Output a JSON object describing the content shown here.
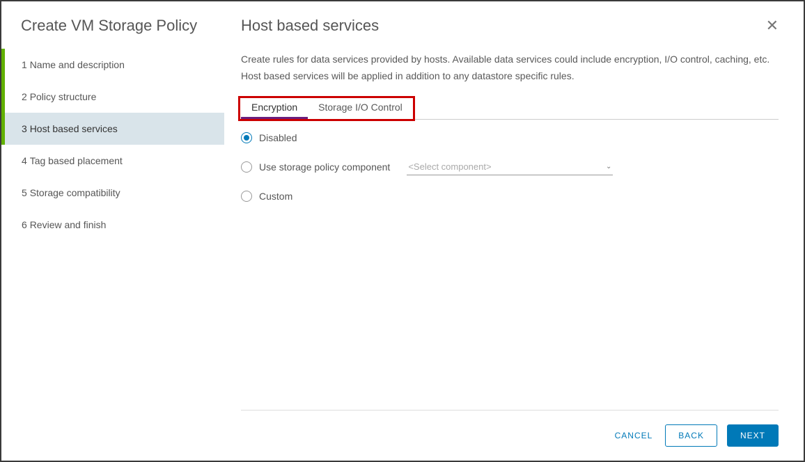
{
  "sidebar": {
    "title": "Create VM Storage Policy",
    "steps": [
      {
        "index": "1",
        "label": "Name and description"
      },
      {
        "index": "2",
        "label": "Policy structure"
      },
      {
        "index": "3",
        "label": "Host based services"
      },
      {
        "index": "4",
        "label": "Tag based placement"
      },
      {
        "index": "5",
        "label": "Storage compatibility"
      },
      {
        "index": "6",
        "label": "Review and finish"
      }
    ]
  },
  "main": {
    "title": "Host based services",
    "description": "Create rules for data services provided by hosts. Available data services could include encryption, I/O control, caching, etc. Host based services will be applied in addition to any datastore specific rules."
  },
  "tabs": {
    "encryption": "Encryption",
    "sioc": "Storage I/O Control"
  },
  "options": {
    "disabled": "Disabled",
    "use_component": "Use storage policy component",
    "select_placeholder": "<Select component>",
    "custom": "Custom"
  },
  "footer": {
    "cancel": "CANCEL",
    "back": "BACK",
    "next": "NEXT"
  }
}
